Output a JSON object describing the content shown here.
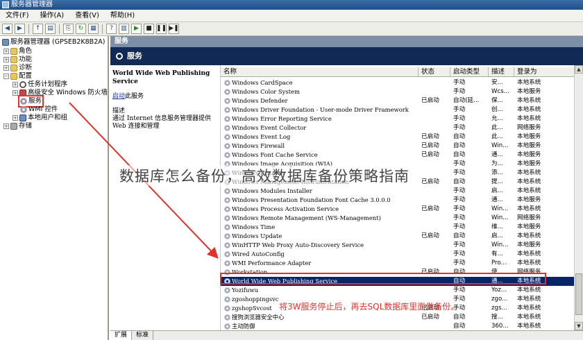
{
  "window": {
    "title": "服务器管理器"
  },
  "menu": [
    "文件(F)",
    "操作(A)",
    "查看(V)",
    "帮助(H)"
  ],
  "toolbar": {
    "buttons": [
      "back-icon",
      "forward-icon",
      "up-folder-icon",
      "show-tree-icon",
      "export-icon",
      "refresh-icon",
      "properties-icon",
      "help-icon",
      "view-icon",
      "start-icon",
      "stop-icon",
      "pause-icon",
      "restart-icon"
    ]
  },
  "tree": {
    "root": "服务器管理器 (GPSEB2K8B2A)",
    "items": [
      "角色",
      "功能",
      "诊断",
      "配置",
      "任务计划程序",
      "高级安全 Windows 防火墙",
      "服务",
      "WMI 控件",
      "本地用户和组",
      "存储"
    ]
  },
  "pane": {
    "header": "服务",
    "subheader": "服务"
  },
  "description": {
    "service_name": "World Wide Web Publishing Service",
    "action_link": "启动",
    "action_suffix": "此服务",
    "desc_label": "描述",
    "desc_text": "通过 Internet 信息服务管理器提供 Web 连接和管理"
  },
  "columns": [
    "名称",
    "状态",
    "启动类型",
    "描述",
    "登录为"
  ],
  "services": [
    {
      "name": "Windows CardSpace",
      "status": "",
      "startup": "手动",
      "desc": "安...",
      "logon": "本地系统"
    },
    {
      "name": "Windows Color System",
      "status": "",
      "startup": "手动",
      "desc": "Wcs...",
      "logon": "本地服务"
    },
    {
      "name": "Windows Defender",
      "status": "已启动",
      "startup": "自动(延...",
      "desc": "保...",
      "logon": "本地系统"
    },
    {
      "name": "Windows Driver Foundation - User-mode Driver Framework",
      "status": "",
      "startup": "手动",
      "desc": "创...",
      "logon": "本地系统"
    },
    {
      "name": "Windows Error Reporting Service",
      "status": "",
      "startup": "手动",
      "desc": "允...",
      "logon": "本地系统"
    },
    {
      "name": "Windows Event Collector",
      "status": "",
      "startup": "手动",
      "desc": "此...",
      "logon": "网络服务"
    },
    {
      "name": "Windows Event Log",
      "status": "已启动",
      "startup": "自动",
      "desc": "此...",
      "logon": "本地服务"
    },
    {
      "name": "Windows Firewall",
      "status": "已启动",
      "startup": "自动",
      "desc": "Win...",
      "logon": "本地服务"
    },
    {
      "name": "Windows Font Cache Service",
      "status": "已启动",
      "startup": "自动",
      "desc": "通...",
      "logon": "本地服务"
    },
    {
      "name": "Windows Image Acquisition (WIA)",
      "status": "",
      "startup": "手动",
      "desc": "为...",
      "logon": "本地服务"
    },
    {
      "name": "Windows Installer",
      "status": "",
      "startup": "手动",
      "desc": "添...",
      "logon": "本地系统"
    },
    {
      "name": "Windows Management Instrumentation",
      "status": "已启动",
      "startup": "自动",
      "desc": "提...",
      "logon": "本地系统"
    },
    {
      "name": "Windows Modules Installer",
      "status": "",
      "startup": "手动",
      "desc": "启...",
      "logon": "本地系统"
    },
    {
      "name": "Windows Presentation Foundation Font Cache 3.0.0.0",
      "status": "",
      "startup": "手动",
      "desc": "通...",
      "logon": "本地服务"
    },
    {
      "name": "Windows Process Activation Service",
      "status": "已启动",
      "startup": "手动",
      "desc": "Win...",
      "logon": "本地系统"
    },
    {
      "name": "Windows Remote Management (WS-Management)",
      "status": "",
      "startup": "手动",
      "desc": "Win...",
      "logon": "网络服务"
    },
    {
      "name": "Windows Time",
      "status": "",
      "startup": "手动",
      "desc": "维...",
      "logon": "本地服务"
    },
    {
      "name": "Windows Update",
      "status": "已启动",
      "startup": "自动",
      "desc": "启...",
      "logon": "本地系统"
    },
    {
      "name": "WinHTTP Web Proxy Auto-Discovery Service",
      "status": "",
      "startup": "手动",
      "desc": "Win...",
      "logon": "本地服务"
    },
    {
      "name": "Wired AutoConfig",
      "status": "",
      "startup": "手动",
      "desc": "有...",
      "logon": "本地系统"
    },
    {
      "name": "WMI Performance Adapter",
      "status": "",
      "startup": "手动",
      "desc": "Pro...",
      "logon": "本地系统"
    },
    {
      "name": "Workstation",
      "status": "已启动",
      "startup": "自动",
      "desc": "使...",
      "logon": "网络服务"
    },
    {
      "name": "World Wide Web Publishing Service",
      "status": "",
      "startup": "自动",
      "desc": "通...",
      "logon": "本地系统"
    },
    {
      "name": "Yozifuwu",
      "status": "",
      "startup": "手动",
      "desc": "Yoz...",
      "logon": "本地系统"
    },
    {
      "name": "zgoshoppingsvc",
      "status": "",
      "startup": "手动",
      "desc": "zgo...",
      "logon": "本地系统"
    },
    {
      "name": "zgshopSvcost",
      "status": "已启动",
      "startup": "手动",
      "desc": "zgs...",
      "logon": "本地系统"
    },
    {
      "name": "搜狗浏览器安全中心",
      "status": "已启动",
      "startup": "自动",
      "desc": "搜...",
      "logon": "本地系统"
    },
    {
      "name": "主动防御",
      "status": "",
      "startup": "自动",
      "desc": "360...",
      "logon": "本地系统"
    }
  ],
  "selected_service": "World Wide Web Publishing Service",
  "tabs": [
    "扩展",
    "标准"
  ],
  "overlay": {
    "watermark": "数据库怎么备份，高效数据库备份策略指南",
    "annotation": "将3W服务停止后，再去SQL数据库里面做备份。",
    "highlight_color": "#e0322c"
  }
}
